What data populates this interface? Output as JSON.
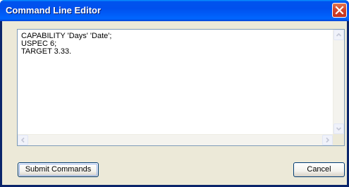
{
  "window": {
    "title": "Command Line Editor"
  },
  "editor": {
    "text": "CAPABILITY 'Days' 'Date';\nUSPEC 6;\nTARGET 3.33."
  },
  "buttons": {
    "submit_label": "Submit Commands",
    "cancel_label": "Cancel"
  },
  "colors": {
    "titlebar": "#0054e3",
    "close_button": "#d2452b",
    "dialog_background": "#ece9d8",
    "editor_border": "#7f9db9"
  },
  "icons": {
    "close": "close-icon",
    "scroll_up": "arrow-up-icon",
    "scroll_down": "arrow-down-icon",
    "scroll_left": "arrow-left-icon",
    "scroll_right": "arrow-right-icon"
  }
}
